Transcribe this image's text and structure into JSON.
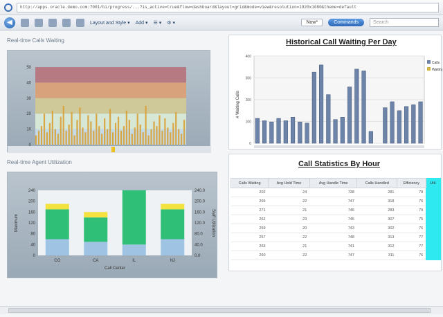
{
  "browser": {
    "url": "http://apps.oracle.demo.com:7001/bi/progress/...?is_active=true&flow=dashboard&layout=grid&mode=view&resolution=1920x1080&theme=default"
  },
  "toolbar": {
    "menus": [
      "Layout and Style ▾",
      "Add ▾",
      "☰ ▾",
      "⚙ ▾"
    ],
    "now_label": "Now*",
    "command_label": "Commands",
    "search_placeholder": "Search"
  },
  "panes": {
    "realtime_calls": "Real-time Calls Waiting",
    "agent_util": "Real-time Agent Utilization"
  },
  "hist_chart": {
    "title": "Historical Call Waiting Per Day",
    "ylabel": "# Waiting Calls",
    "yticks": [
      "400",
      "300",
      "200",
      "100",
      "0"
    ],
    "legend": [
      "Calls",
      "Waiting"
    ],
    "bars": [
      42,
      38,
      36,
      42,
      38,
      44,
      36,
      34,
      120,
      132,
      82,
      40,
      44,
      95,
      125,
      122,
      20,
      0,
      60,
      70,
      55,
      62,
      65,
      70
    ],
    "colors": {
      "bar": "#6d84a8",
      "edge": "#3f5578"
    }
  },
  "stats": {
    "title": "Call Statistics By Hour",
    "columns": [
      "Calls Waiting",
      "Avg Hold Time",
      "Avg Handle Time",
      "Calls Handled",
      "Efficiency",
      "Util."
    ],
    "rows": [
      [
        "202",
        "24",
        "738",
        "281",
        "78"
      ],
      [
        "265",
        "22",
        "747",
        "318",
        "76"
      ],
      [
        "271",
        "21",
        "746",
        "283",
        "79"
      ],
      [
        "262",
        "23",
        "745",
        "307",
        "75"
      ],
      [
        "259",
        "20",
        "743",
        "302",
        "76"
      ],
      [
        "257",
        "22",
        "748",
        "313",
        "77"
      ],
      [
        "263",
        "21",
        "741",
        "312",
        "77"
      ],
      [
        "260",
        "22",
        "747",
        "311",
        "76"
      ]
    ]
  },
  "realtime_chart": {
    "yticks": [
      "50",
      "40",
      "30",
      "20",
      "10",
      "0"
    ],
    "bands": [
      "#b67a82",
      "#d7a27c",
      "#cfc99a",
      "#d6e7d6",
      "#c4dbe7"
    ],
    "spikes": [
      6,
      9,
      12,
      20,
      8,
      14,
      22,
      10,
      7,
      18,
      25,
      9,
      13,
      21,
      6,
      16,
      24,
      11,
      8,
      19,
      15,
      9,
      20,
      12,
      7,
      17,
      10,
      23,
      8,
      14,
      18,
      9,
      12,
      22,
      16,
      7,
      11,
      20,
      13,
      8,
      25,
      6,
      10,
      15,
      12,
      19,
      9,
      17,
      11,
      8,
      14,
      21,
      10,
      7,
      16
    ]
  },
  "agent_chart": {
    "xlabel": "Call Center",
    "ylabel_left": "Maximum",
    "ylabel_right": "Staff Utilization",
    "yticks_left": [
      "240",
      "200",
      "160",
      "120",
      "80",
      "40",
      "0"
    ],
    "yticks_right": [
      "240.0",
      "200.0",
      "160.0",
      "120.0",
      "80.0",
      "40.0",
      "0.0"
    ],
    "categories": [
      "CO",
      "CA",
      "IL",
      "NJ"
    ],
    "segments": [
      {
        "blue": 60,
        "green": 110,
        "yellow": 20
      },
      {
        "blue": 50,
        "green": 90,
        "yellow": 20
      },
      {
        "blue": 40,
        "green": 200,
        "yellow": 0
      },
      {
        "blue": 60,
        "green": 110,
        "yellow": 20
      }
    ],
    "colors": {
      "blue": "#9ec3e3",
      "green": "#2fbf76",
      "yellow": "#f3e23f"
    }
  }
}
